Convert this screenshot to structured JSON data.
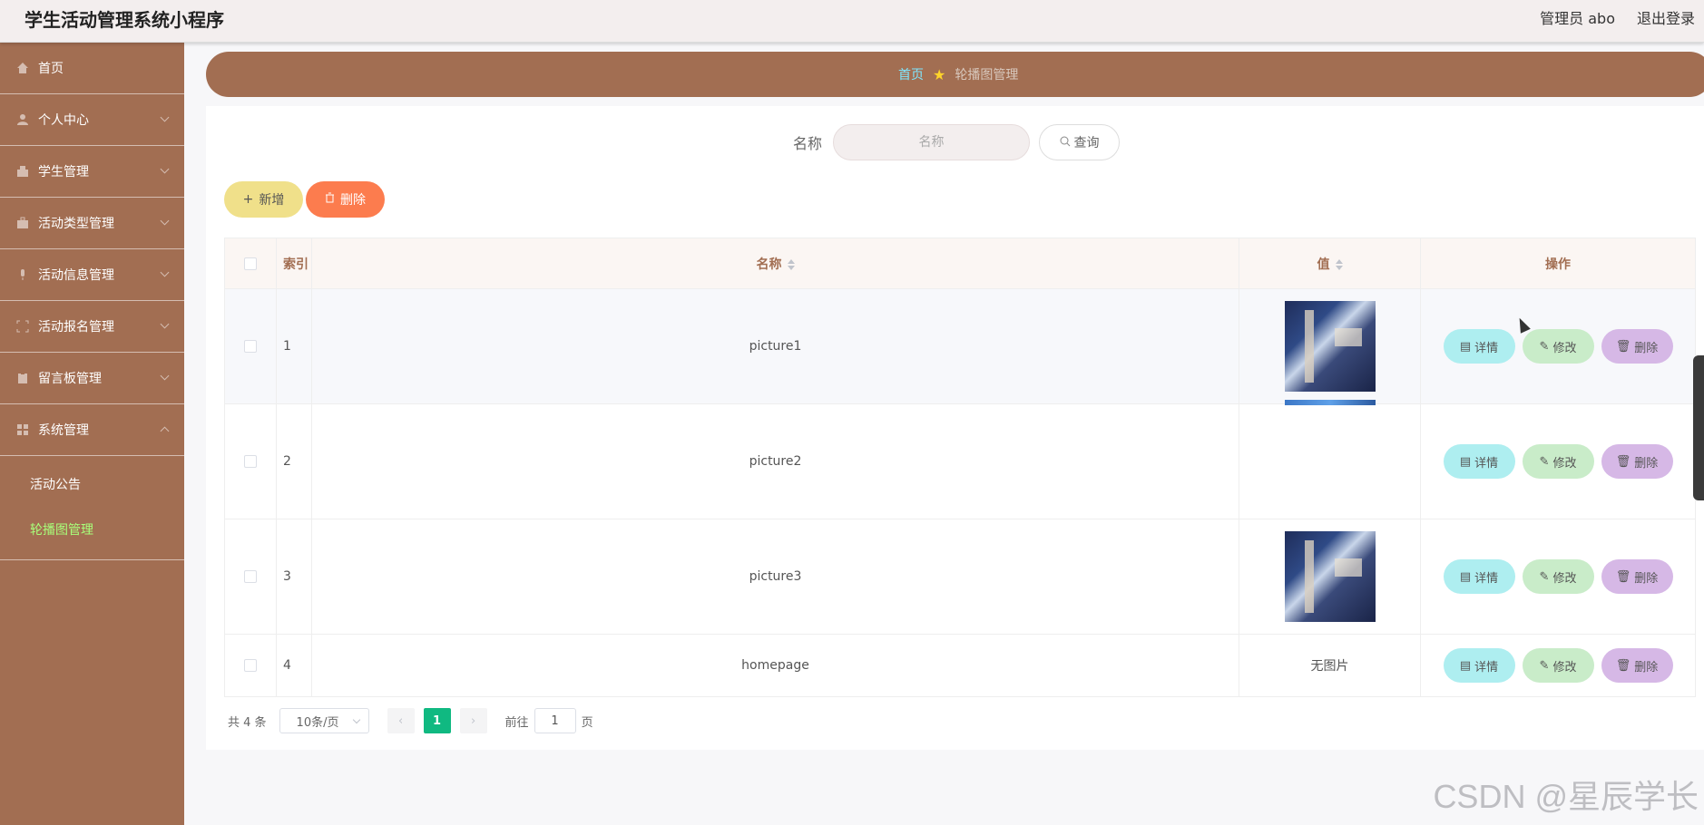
{
  "header": {
    "app_title": "学生活动管理系统小程序",
    "user_label": "管理员 abo",
    "logout_label": "退出登录"
  },
  "sidebar": {
    "items": [
      {
        "label": "首页",
        "icon": "home-icon"
      },
      {
        "label": "个人中心",
        "icon": "user-icon"
      },
      {
        "label": "学生管理",
        "icon": "student-icon"
      },
      {
        "label": "活动类型管理",
        "icon": "briefcase-icon"
      },
      {
        "label": "活动信息管理",
        "icon": "mic-icon"
      },
      {
        "label": "活动报名管理",
        "icon": "frame-icon"
      },
      {
        "label": "留言板管理",
        "icon": "clipboard-icon"
      },
      {
        "label": "系统管理",
        "icon": "grid-icon"
      }
    ],
    "submenu": [
      {
        "label": "活动公告",
        "active": false
      },
      {
        "label": "轮播图管理",
        "active": true
      }
    ]
  },
  "breadcrumb": {
    "home": "首页",
    "current": "轮播图管理"
  },
  "search": {
    "label": "名称",
    "placeholder": "名称",
    "button_label": "查询"
  },
  "actions": {
    "add_label": "新增",
    "delete_label": "删除"
  },
  "table": {
    "columns": {
      "index": "索引",
      "name": "名称",
      "value": "值",
      "ops": "操作"
    },
    "rows": [
      {
        "index": "1",
        "name": "picture1",
        "value": "image"
      },
      {
        "index": "2",
        "name": "picture2",
        "value": "image-broken"
      },
      {
        "index": "3",
        "name": "picture3",
        "value": "image"
      },
      {
        "index": "4",
        "name": "homepage",
        "value": "无图片"
      }
    ],
    "op_labels": {
      "detail": "详情",
      "edit": "修改",
      "delete": "删除"
    }
  },
  "pagination": {
    "total": "共 4 条",
    "page_size": "10条/页",
    "current_page": "1",
    "goto_label": "前往",
    "goto_value": "1",
    "goto_suffix": "页"
  },
  "watermark": "CSDN @星辰学长",
  "colors": {
    "sidebar": "#a26e52",
    "accent_green": "#10b981",
    "active_submenu": "#a8ff7a"
  }
}
